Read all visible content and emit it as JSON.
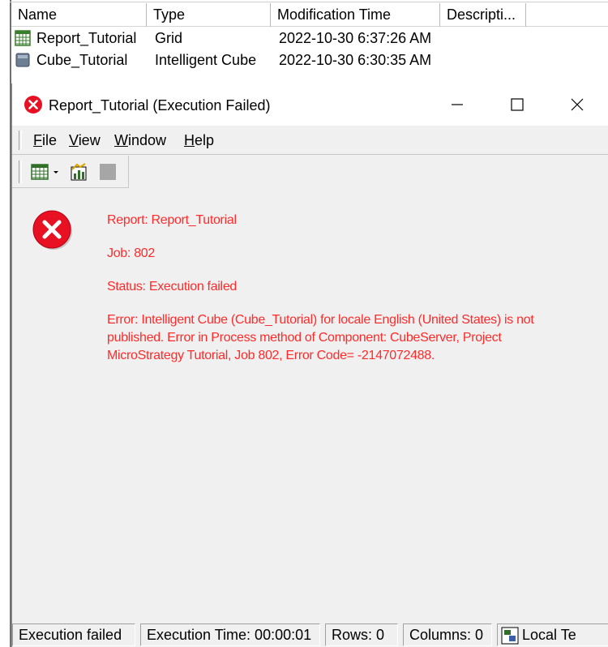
{
  "list": {
    "columns": [
      "Name",
      "Type",
      "Modification Time",
      "Descripti..."
    ],
    "rows": [
      {
        "name": "Report_Tutorial",
        "type": "Grid",
        "modified": "2022-10-30 6:37:26 AM",
        "icon": "grid-report-icon"
      },
      {
        "name": "Cube_Tutorial",
        "type": "Intelligent Cube",
        "modified": "2022-10-30 6:30:35 AM",
        "icon": "intelligent-cube-icon"
      }
    ]
  },
  "window": {
    "title": "Report_Tutorial (Execution Failed)",
    "title_icon": "error-icon",
    "controls": {
      "minimize": "minimize-icon",
      "maximize": "maximize-icon",
      "close": "close-icon"
    }
  },
  "menu": {
    "items": [
      {
        "label": "File",
        "mnemonic": "F",
        "rest": "ile"
      },
      {
        "label": "View",
        "mnemonic": "V",
        "rest": "iew"
      },
      {
        "label": "Window",
        "mnemonic": "W",
        "rest": "indow"
      },
      {
        "label": "Help",
        "mnemonic": "H",
        "rest": "elp"
      }
    ]
  },
  "toolbar": {
    "buttons": [
      "grid-view-icon",
      "dropdown-arrow-icon",
      "graph-view-icon",
      "stop-icon"
    ]
  },
  "message": {
    "report": "Report: Report_Tutorial",
    "job": "Job: 802",
    "status": "Status: Execution failed",
    "error_lines": [
      "Error: Intelligent Cube (Cube_Tutorial) for locale English (United States) is not",
      "published. Error in Process method of Component: CubeServer, Project",
      "MicroStrategy Tutorial, Job 802, Error Code= -2147072488."
    ]
  },
  "statusbar": {
    "state": "Execution failed",
    "execution_time": "Execution Time: 00:00:01",
    "rows": "Rows: 0",
    "columns": "Columns: 0",
    "connection": "Local Te"
  },
  "colors": {
    "error_text": "#ff2a2a",
    "error_icon": "#e81123",
    "window_bg": "#f0f0f0"
  }
}
